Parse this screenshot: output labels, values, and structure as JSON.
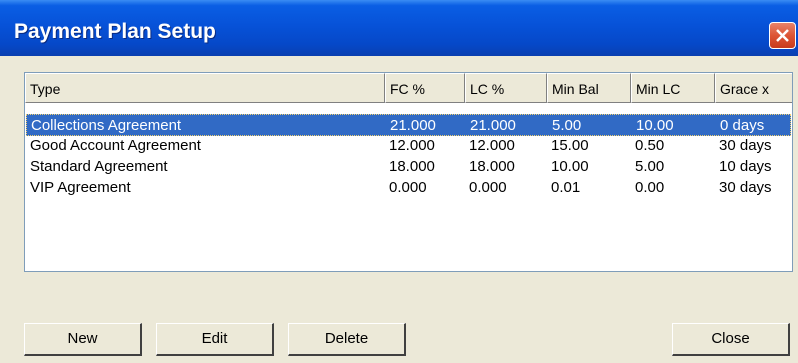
{
  "window": {
    "title": "Payment Plan Setup"
  },
  "list": {
    "columns": [
      "Type",
      "FC %",
      "LC %",
      "Min Bal",
      "Min LC",
      "Grace x"
    ],
    "rows": [
      {
        "type": "Collections Agreement",
        "fc": "21.000",
        "lc": "21.000",
        "min_bal": "5.00",
        "min_lc": "10.00",
        "grace": "0 days",
        "selected": true
      },
      {
        "type": "Good Account Agreement",
        "fc": "12.000",
        "lc": "12.000",
        "min_bal": "15.00",
        "min_lc": "0.50",
        "grace": "30 days"
      },
      {
        "type": "Standard Agreement",
        "fc": "18.000",
        "lc": "18.000",
        "min_bal": "10.00",
        "min_lc": "5.00",
        "grace": "10 days"
      },
      {
        "type": "VIP Agreement",
        "fc": "0.000",
        "lc": "0.000",
        "min_bal": "0.01",
        "min_lc": "0.00",
        "grace": "30 days"
      }
    ]
  },
  "buttons": {
    "new": "New",
    "edit": "Edit",
    "delete": "Delete",
    "close": "Close"
  },
  "colors": {
    "titlebar": "#0752d8",
    "selection": "#316ac5",
    "face": "#ece9d8",
    "close": "#dd5535"
  },
  "icons": {
    "close": "close-icon"
  }
}
